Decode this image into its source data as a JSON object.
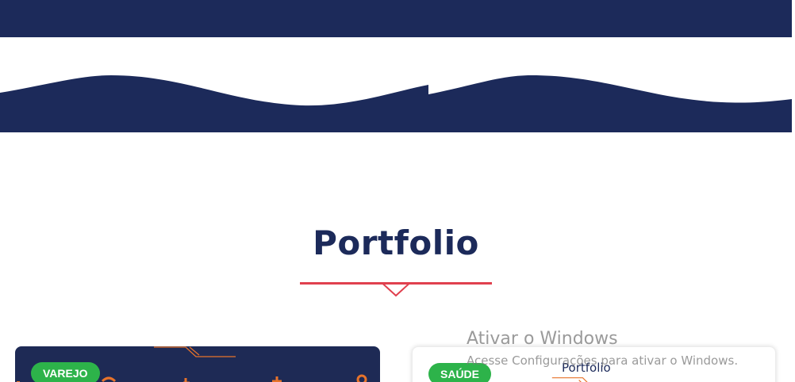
{
  "colors": {
    "navy": "#1c2a5a",
    "accent_red": "#e0404e",
    "badge_green": "#2db34a",
    "orange_deco": "#e8732a"
  },
  "portfolio": {
    "title": "Portfolio"
  },
  "cards": [
    {
      "category": "VAREJO"
    },
    {
      "category": "SAÚDE",
      "label": "Portfolio"
    }
  ],
  "windows_watermark": {
    "title": "Ativar o Windows",
    "subtitle": "Acesse Configurações para ativar o Windows."
  }
}
